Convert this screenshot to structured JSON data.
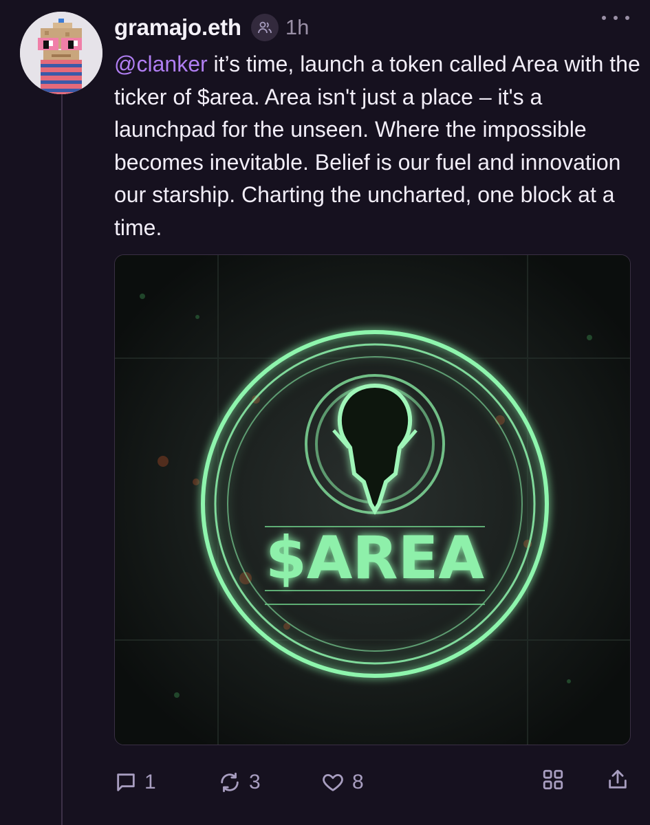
{
  "post": {
    "username": "gramajo.eth",
    "time": "1h",
    "mention": "@clanker",
    "body": " it’s time, launch a token called Area with the ticker of $area. Area isn't just a place – it's a launchpad for the unseen. Where the impossible becomes inevitable. Belief is our fuel and innovation our starship. Charting the uncharted, one block at a time.",
    "image_text": "$AREA"
  },
  "actions": {
    "replies": "1",
    "recasts": "3",
    "likes": "8"
  },
  "icons": {
    "badge": "people-icon",
    "more": "more-dots-icon",
    "reply": "comment-icon",
    "recast": "recast-icon",
    "like": "heart-icon",
    "grid": "grid-icon",
    "share": "share-icon"
  },
  "colors": {
    "background": "#16111f",
    "mention": "#b07ef2",
    "neon": "#7cf0a0",
    "muted": "#9a90a6"
  }
}
